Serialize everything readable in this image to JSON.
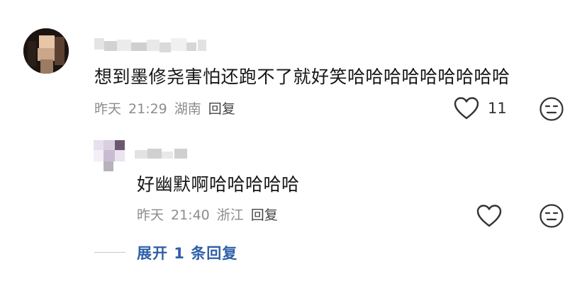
{
  "comment": {
    "text": "想到墨修尧害怕还跑不了就好笑哈哈哈哈哈哈哈哈哈",
    "date": "昨天",
    "time": "21:29",
    "location": "湖南",
    "reply_label": "回复",
    "like_count": "11",
    "icons": {
      "like": "heart-icon",
      "emoji": "neutral-face-icon"
    }
  },
  "reply": {
    "text": "好幽默啊哈哈哈哈哈",
    "date": "昨天",
    "time": "21:40",
    "location": "浙江",
    "reply_label": "回复",
    "icons": {
      "like": "heart-icon",
      "emoji": "neutral-face-icon"
    }
  },
  "expand": {
    "label": "展开 1 条回复"
  },
  "colors": {
    "accent": "#2f5fa8",
    "meta": "#8c8c8c",
    "text": "#151515"
  }
}
